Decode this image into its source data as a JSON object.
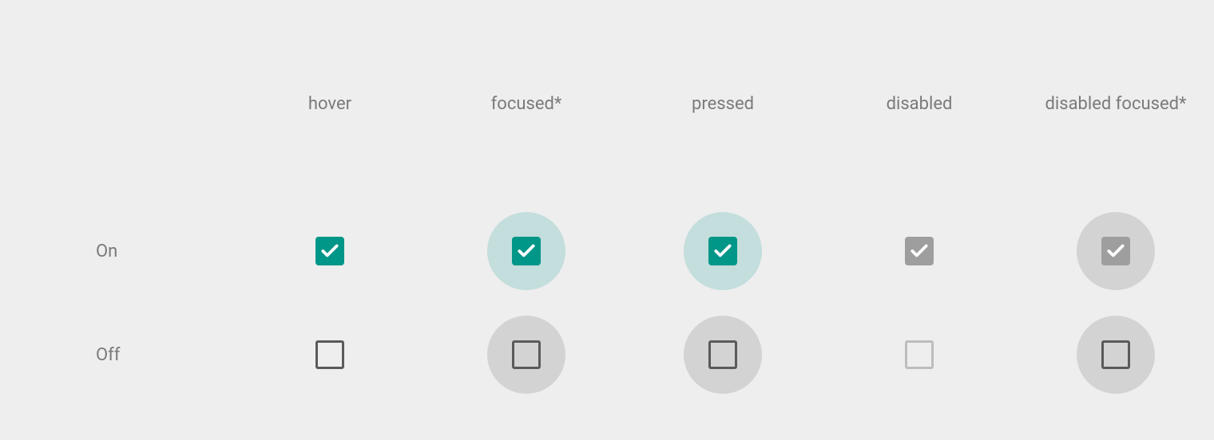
{
  "headers": {
    "hover": "hover",
    "focused": "focused*",
    "pressed": "pressed",
    "disabled": "disabled",
    "disabledFocused": "disabled focused*"
  },
  "rows": {
    "on": "On",
    "off": "Off"
  },
  "colors": {
    "accent": "#009688",
    "disabled": "#9e9e9e",
    "uncheckedBorder": "#5a5a5a",
    "uncheckedDisabledBorder": "#bdbdbd"
  }
}
